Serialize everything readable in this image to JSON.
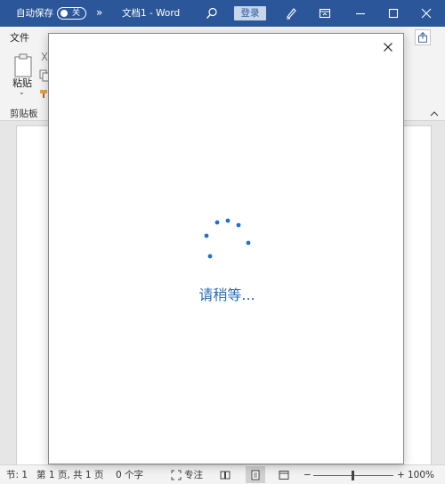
{
  "titlebar": {
    "autosave_label": "自动保存",
    "autosave_state": "关",
    "more_glyph": "»",
    "doc_title": "文档1  -  Word",
    "login_label": "登录",
    "color": "#2b579a"
  },
  "ribbon": {
    "file_tab": "文件",
    "paste_label": "粘贴",
    "paste_arrow": "⌄",
    "group_clipboard": "剪贴板"
  },
  "dialog": {
    "wait_text": "请稍等..."
  },
  "statusbar": {
    "section": "节: 1",
    "page": "第 1 页, 共 1 页",
    "words": "0 个字",
    "focus": "专注",
    "zoom_minus": "−",
    "zoom_plus": "+",
    "zoom": "100%"
  },
  "icons": [
    "search-icon",
    "pen-icon",
    "ribbon-display-icon",
    "minimize-icon",
    "maximize-icon",
    "close-icon",
    "share-icon",
    "paste-icon",
    "cut-icon",
    "copy-icon",
    "format-painter-icon",
    "collapse-ribbon-icon",
    "focus-icon",
    "read-mode-icon",
    "print-layout-icon",
    "web-layout-icon",
    "spinner-icon"
  ]
}
